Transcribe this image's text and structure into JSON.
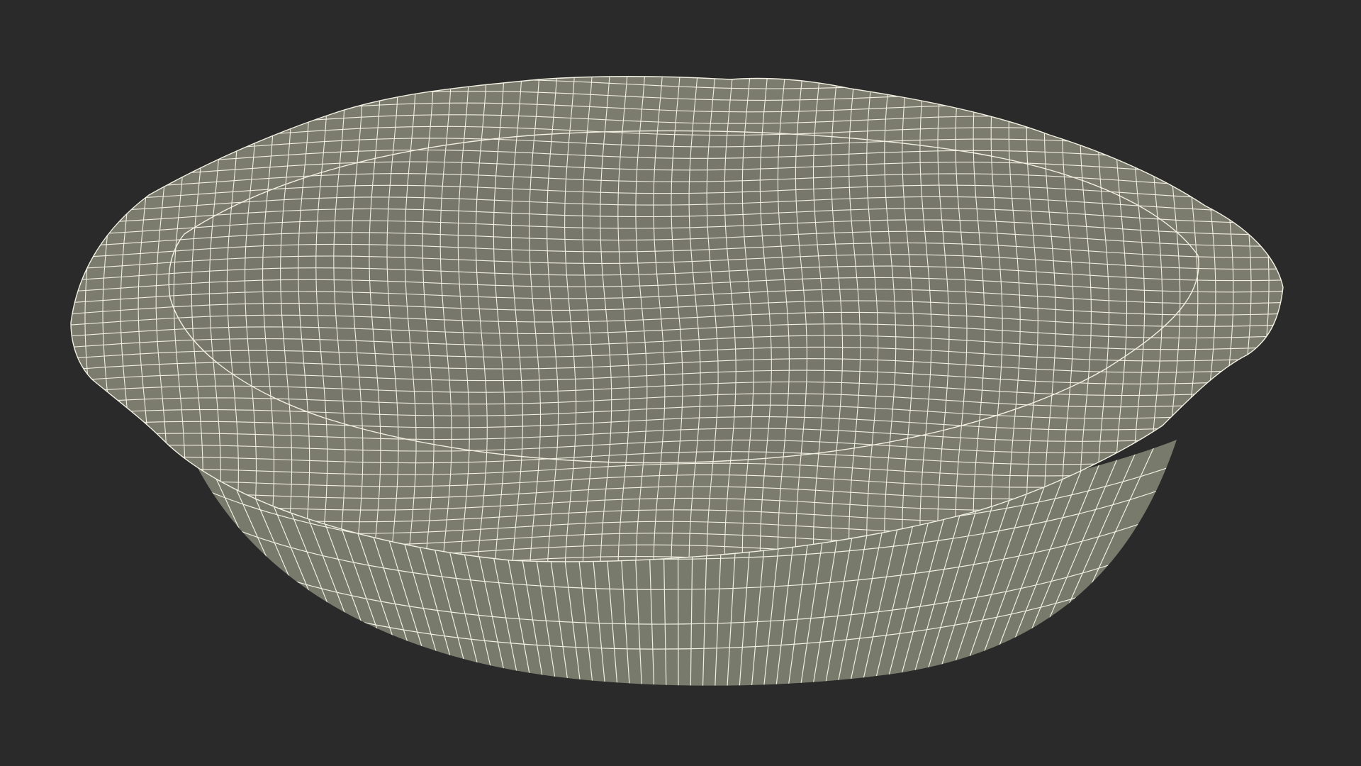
{
  "scene": {
    "subject": "pie-wireframe-render",
    "colors": {
      "background": "#2a2a2a",
      "surface_top": "#7b7b6e",
      "surface_side": "#787a6c",
      "surface_rim": "#7e7f72",
      "surface_shadow": "#6c6d61",
      "wire": "#f1f0e2"
    }
  }
}
